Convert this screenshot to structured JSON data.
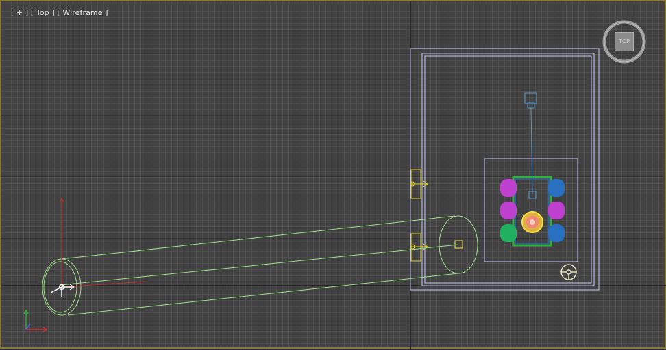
{
  "viewport": {
    "label_plus": "[ + ]",
    "label_view": "[ Top ]",
    "label_shading": "[ Wireframe ]"
  },
  "viewcube": {
    "face_label": "TOP"
  },
  "colors": {
    "frame_border": "#8a7a3a",
    "grid_background": "#424242",
    "room_outline": "#c8c8ff",
    "camera_frustum": "#a0e08a",
    "axis_x": "#d03030",
    "axis_y": "#30b030",
    "axis_z": "#4060ff",
    "chair_magenta": "#c040d0",
    "chair_blue": "#2a70c0",
    "chair_green": "#20b060",
    "table_outline": "#30b040",
    "light_line": "#5a9ad0",
    "door_helper": "#e0d020"
  },
  "icons": [
    "viewcube-icon",
    "axis-tripod-icon",
    "camera-icon",
    "steering-wheel-icon",
    "chandelier-icon",
    "door-icon"
  ]
}
